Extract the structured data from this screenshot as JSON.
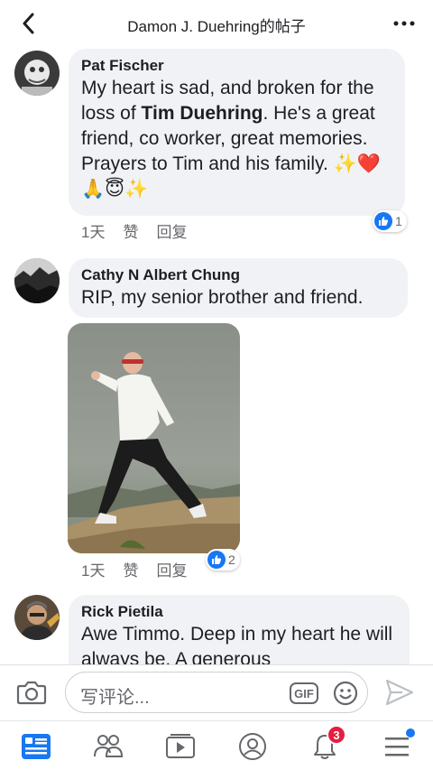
{
  "header": {
    "title": "Damon J. Duehring的帖子",
    "back_icon": "chevron-left-icon",
    "more_icon": "more-dots-icon"
  },
  "comments": [
    {
      "author": "Pat Fischer",
      "text_before": "My heart is sad, and broken for the loss of ",
      "text_bold": "Tim Duehring",
      "text_after": ". He's a great friend, co worker, great memories. Prayers to Tim and his family. ✨❤️🙏😇✨",
      "time": "1天",
      "like_label": "赞",
      "reply_label": "回复",
      "reaction_count": "1"
    },
    {
      "author": "Cathy N Albert Chung",
      "text": "RIP, my senior brother and friend.",
      "time": "1天",
      "like_label": "赞",
      "reply_label": "回复",
      "reaction_count": "2"
    },
    {
      "author": "Rick Pietila",
      "text": "Awe Timmo.  Deep in my heart he will always be. A generous"
    }
  ],
  "composer": {
    "placeholder": "写评论...",
    "gif_label": "GIF"
  },
  "bottom_nav": {
    "notification_count": "3"
  },
  "colors": {
    "accent": "#1877f2",
    "bubble": "#f0f2f5",
    "badge": "#e41e3f"
  }
}
